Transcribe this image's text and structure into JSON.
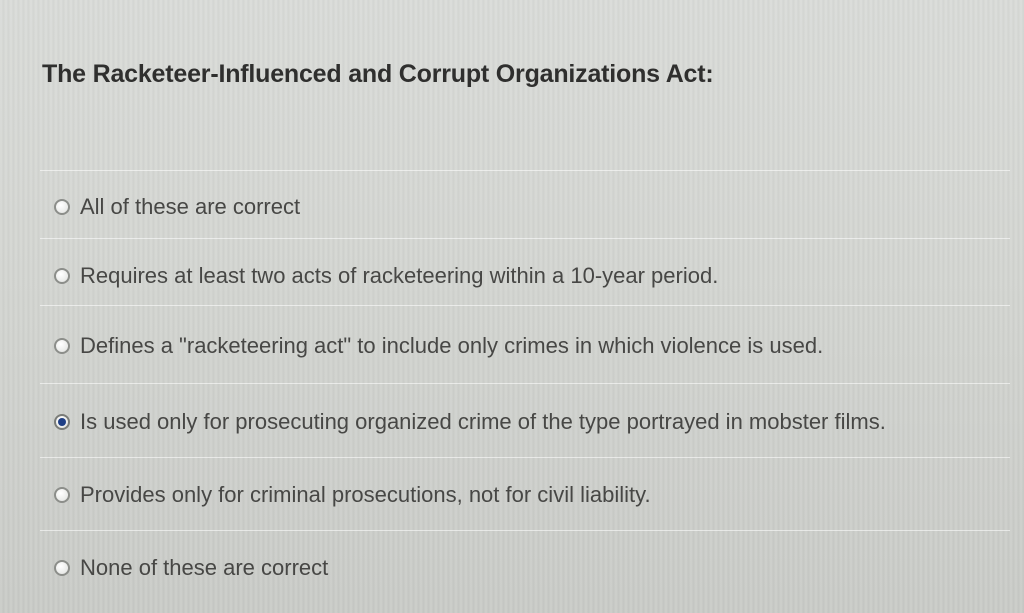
{
  "question": {
    "title": "The Racketeer-Influenced and Corrupt Organizations Act:"
  },
  "answers": [
    {
      "label": "All of these are correct",
      "selected": false
    },
    {
      "label": "Requires at least two acts of racketeering within a 10-year period.",
      "selected": false
    },
    {
      "label": "Defines a \"racketeering act\" to include only crimes in which violence is used.",
      "selected": false
    },
    {
      "label": "Is used only for prosecuting organized crime of the type portrayed in mobster films.",
      "selected": true
    },
    {
      "label": "Provides only for criminal prosecutions, not for civil liability.",
      "selected": false
    },
    {
      "label": "None of these are correct",
      "selected": false
    }
  ],
  "colors": {
    "selected_dot": "#1f3f86",
    "background": "#d5d7d3"
  }
}
